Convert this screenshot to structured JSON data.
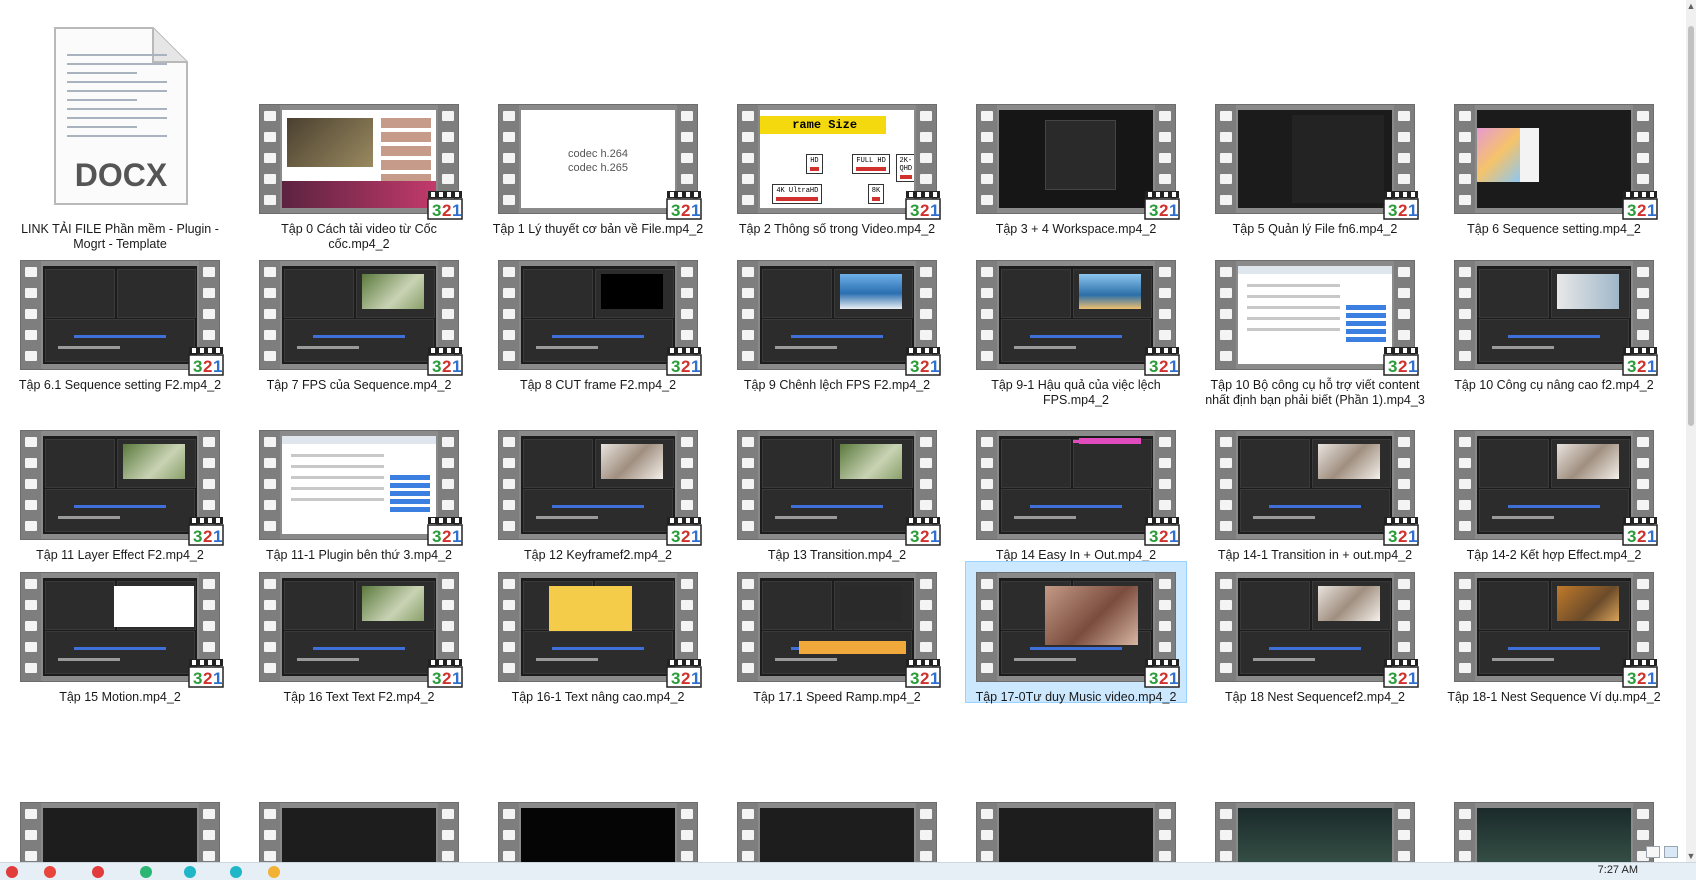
{
  "window": {
    "items": [
      {
        "type": "docx",
        "icon_text": "DOCX",
        "name": "LINK TẢI FILE Phần mềm - Plugin - Mogrt - Template"
      },
      {
        "type": "video",
        "name": "Tập 0 Cách tải video từ Cốc cốc.mp4_2",
        "thumb": "browser"
      },
      {
        "type": "video",
        "name": "Tập 1 Lý thuyết cơ bản về File.mp4_2",
        "thumb": "codec",
        "lines": [
          "codec h.264",
          "codec h.265"
        ]
      },
      {
        "type": "video",
        "name": "Tập 2 Thông số trong Video.mp4_2",
        "thumb": "framesize",
        "heading": "rame Size",
        "boxes": [
          "HD",
          "FULL HD",
          "2K-QHD",
          "4K UltraHD",
          "8K"
        ]
      },
      {
        "type": "video",
        "name": "Tập 3 + 4 Workspace.mp4_2",
        "thumb": "dialog"
      },
      {
        "type": "video",
        "name": "Tập 5 Quản lý File fn6.mp4_2",
        "thumb": "dark"
      },
      {
        "type": "video",
        "name": "Tập 6 Sequence setting.mp4_2",
        "thumb": "swatch"
      },
      {
        "type": "video",
        "name": "Tập 6.1 Sequence setting F2.mp4_2",
        "thumb": "editor"
      },
      {
        "type": "video",
        "name": "Tập 7 FPS của Sequence.mp4_2",
        "thumb": "editor-photo"
      },
      {
        "type": "video",
        "name": "Tập 8 CUT frame F2.mp4_2",
        "thumb": "editor-black"
      },
      {
        "type": "video",
        "name": "Tập 9 Chênh lệch FPS F2.mp4_2",
        "thumb": "editor-sea"
      },
      {
        "type": "video",
        "name": "Tập 9-1 Hậu quả của việc lệch FPS.mp4_2",
        "thumb": "editor-sea2"
      },
      {
        "type": "video",
        "name": "Tập 10 Bộ công cụ hỗ trợ viết content nhất định bạn phải biết (Phần 1).mp4_3",
        "thumb": "web"
      },
      {
        "type": "video",
        "name": "Tập 10 Công cụ nâng cao f2.mp4_2",
        "thumb": "editor-arrow"
      },
      {
        "type": "video",
        "name": "Tập 11 Layer Effect F2.mp4_2",
        "thumb": "editor-photo"
      },
      {
        "type": "video",
        "name": "Tập 11-1 Plugin bên thứ 3.mp4_2",
        "thumb": "web"
      },
      {
        "type": "video",
        "name": "Tập 12 Keyframef2.mp4_2",
        "thumb": "editor-person"
      },
      {
        "type": "video",
        "name": "Tập 13 Transition.mp4_2",
        "thumb": "editor-photo"
      },
      {
        "type": "video",
        "name": "Tập 14 Easy In + Out.mp4_2",
        "thumb": "editor-pink"
      },
      {
        "type": "video",
        "name": "Tập 14-1 Transition in + out.mp4_2",
        "thumb": "editor-person"
      },
      {
        "type": "video",
        "name": "Tập 14-2 Kết hợp Effect.mp4_2",
        "thumb": "editor-person"
      },
      {
        "type": "video",
        "name": "Tập 15 Motion.mp4_2",
        "thumb": "editor-white"
      },
      {
        "type": "video",
        "name": "Tập 16 Text Text F2.mp4_2",
        "thumb": "editor-photo"
      },
      {
        "type": "video",
        "name": "Tập 16-1 Text nâng cao.mp4_2",
        "thumb": "editor-yellow"
      },
      {
        "type": "video",
        "name": "Tập 17.1 Speed Ramp.mp4_2",
        "thumb": "editor-orange"
      },
      {
        "type": "video",
        "name": "Tập 17-0Tư duy Music video.mp4_2",
        "thumb": "editor-face",
        "selected": true
      },
      {
        "type": "video",
        "name": "Tập 18 Nest Sequencef2.mp4_2",
        "thumb": "editor-person"
      },
      {
        "type": "video",
        "name": "Tập 18-1 Nest Sequence Ví dụ.mp4_2",
        "thumb": "editor-autumn"
      }
    ],
    "partial_row_count": 7
  },
  "badge_text": "321",
  "taskbar": {
    "clock": "7:27 AM"
  },
  "colors": {
    "selection": "#cce8ff",
    "film": "#7e7e7e",
    "badge_green": "#2a9d3a",
    "badge_red": "#d0312d",
    "badge_blue": "#2f6fd0"
  }
}
